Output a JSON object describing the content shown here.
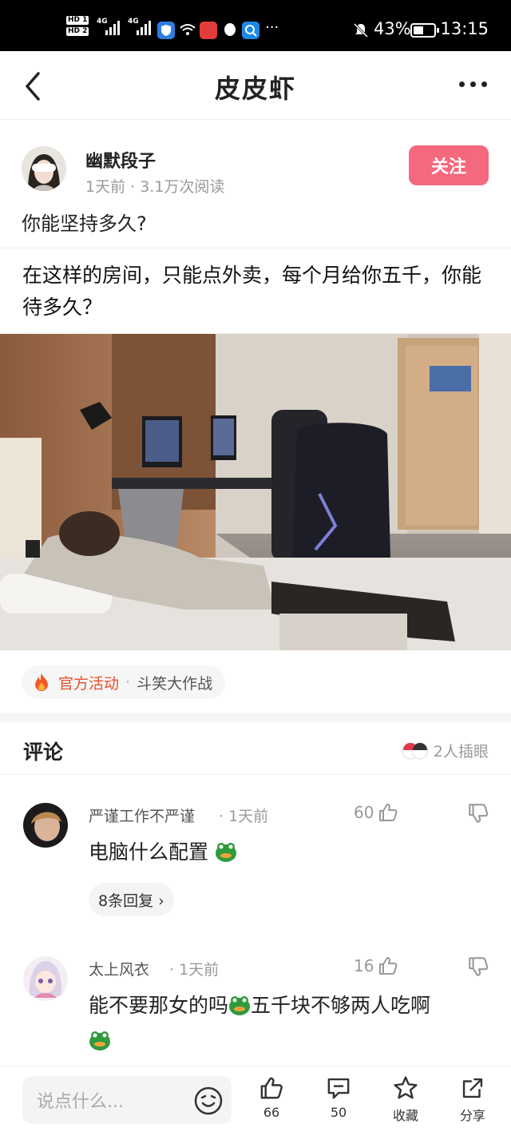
{
  "status_bar": {
    "hd1": "HD 1",
    "hd2": "HD 2",
    "net1": "4G",
    "net2": "4G",
    "battery_pct": "43%",
    "time": "13:15",
    "dots": "···"
  },
  "nav": {
    "title": "皮皮虾"
  },
  "author": {
    "name": "幽默段子",
    "meta": "1天前 · 3.1万次阅读",
    "follow_label": "关注"
  },
  "post": {
    "title": "你能坚持多久?",
    "caption": "在这样的房间，只能点外卖，每个月给你五千，你能待多久？"
  },
  "activity": {
    "tag": "官方活动",
    "sep": "·",
    "name": "斗笑大作战"
  },
  "comments_header": {
    "label": "评论",
    "reactions": "2人插眼"
  },
  "comments": [
    {
      "user": "严谨工作不严谨",
      "time": "· 1天前",
      "likes": "60",
      "text": "电脑什么配置",
      "replies": "8条回复 ›"
    },
    {
      "user": "太上风衣",
      "time": "· 1天前",
      "likes": "16",
      "text": "能不要那女的吗",
      "text2": "五千块不够两人吃啊"
    }
  ],
  "bottom_bar": {
    "input_placeholder": "说点什么...",
    "like_count": "66",
    "comment_count": "50",
    "favorite_label": "收藏",
    "share_label": "分享"
  },
  "colors": {
    "accent": "#f4697d",
    "activity": "#e8502c",
    "emoji": "#2f9a3e"
  }
}
